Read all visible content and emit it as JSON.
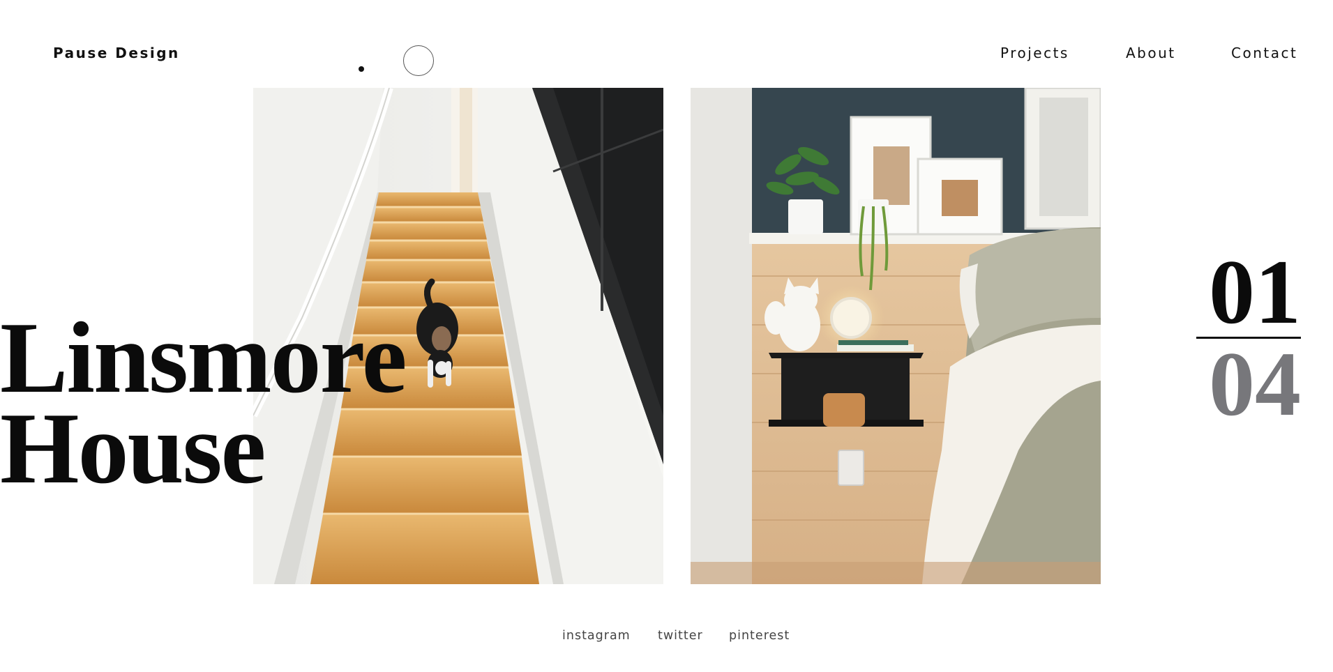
{
  "header": {
    "brand": "Pause Design",
    "nav": {
      "projects": "Projects",
      "about": "About",
      "contact": "Contact"
    }
  },
  "project": {
    "title_line1": "Linsmore",
    "title_line2": "House",
    "current": "01",
    "total": "04"
  },
  "social": {
    "instagram": "instagram",
    "twitter": "twitter",
    "pinterest": "pinterest"
  },
  "colors": {
    "background": "#ffffff",
    "text": "#111111",
    "counter_total": "#77777b",
    "wood": "#d9a45a"
  },
  "icons": {
    "cursor": "cursor-dot-icon"
  }
}
